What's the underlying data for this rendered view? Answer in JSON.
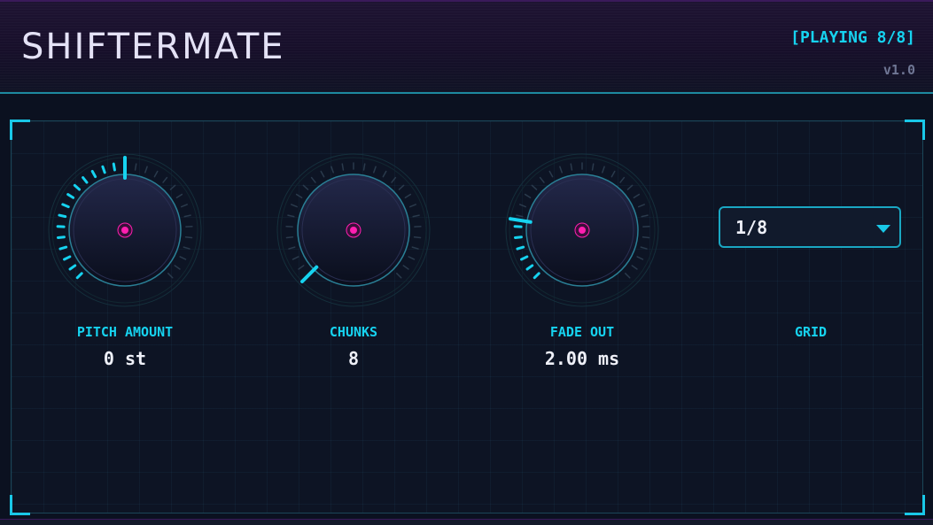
{
  "app": {
    "title": "SHIFTERMATE",
    "status": "[PLAYING 8/8]",
    "version": "v1.0"
  },
  "colors": {
    "accent": "#16d3f0",
    "indicator_dot": "#ff1fb0",
    "background": "#0b1120"
  },
  "controls": {
    "pitch": {
      "label": "PITCH AMOUNT",
      "value": "0 st",
      "level": 0.5
    },
    "chunks": {
      "label": "CHUNKS",
      "value": "8",
      "level": 0.0
    },
    "fade": {
      "label": "FADE OUT",
      "value": "2.00 ms",
      "level": 0.2
    },
    "grid": {
      "label": "GRID",
      "selected": "1/8"
    }
  }
}
